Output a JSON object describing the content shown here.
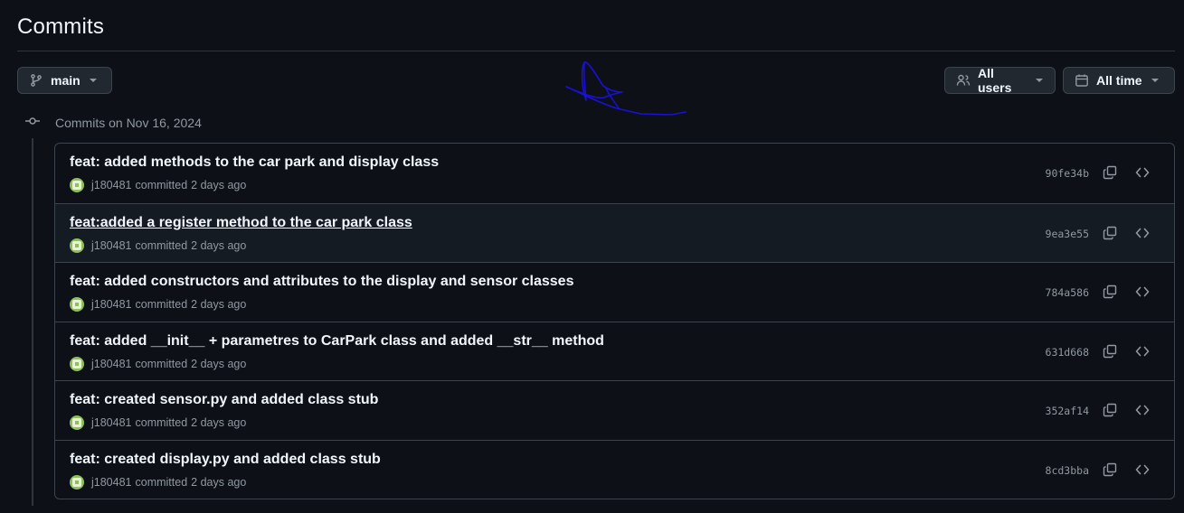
{
  "page": {
    "title": "Commits"
  },
  "toolbar": {
    "branch": "main",
    "users_filter": "All users",
    "time_filter": "All time"
  },
  "group": {
    "date_label": "Commits on Nov 16, 2024"
  },
  "commits": [
    {
      "title": "feat: added methods to the car park and display class",
      "author": "j180481",
      "action": "committed",
      "time": "2 days ago",
      "sha": "90fe34b"
    },
    {
      "title": "feat:added a register method to the car park class",
      "author": "j180481",
      "action": "committed",
      "time": "2 days ago",
      "sha": "9ea3e55"
    },
    {
      "title": "feat: added constructors and attributes to the display and sensor classes",
      "author": "j180481",
      "action": "committed",
      "time": "2 days ago",
      "sha": "784a586"
    },
    {
      "title": "feat: added __init__ + parametres to CarPark class and added __str__ method",
      "author": "j180481",
      "action": "committed",
      "time": "2 days ago",
      "sha": "631d668"
    },
    {
      "title": "feat: created sensor.py and added class stub",
      "author": "j180481",
      "action": "committed",
      "time": "2 days ago",
      "sha": "352af14"
    },
    {
      "title": "feat: created display.py and added class stub",
      "author": "j180481",
      "action": "committed",
      "time": "2 days ago",
      "sha": "8cd3bba"
    }
  ],
  "colors": {
    "background": "#0d1117",
    "border": "#3d444d",
    "text_primary": "#f0f6fc",
    "text_muted": "#9198a1",
    "scribble": "#1a10d6"
  }
}
